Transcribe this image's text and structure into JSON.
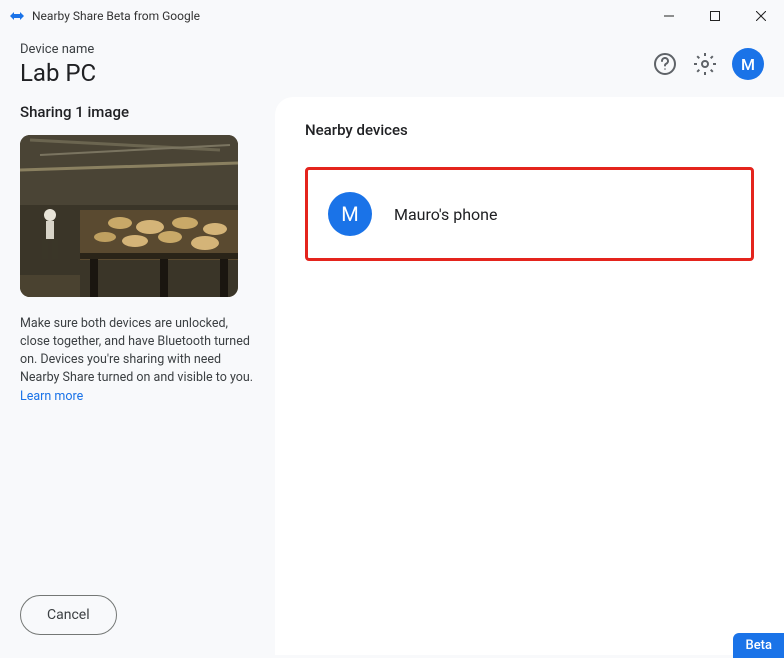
{
  "titlebar": {
    "title": "Nearby Share Beta from Google"
  },
  "header": {
    "device_label": "Device name",
    "device_name": "Lab PC",
    "avatar_initial": "M"
  },
  "left": {
    "sharing_title": "Sharing 1 image",
    "instructions": "Make sure both devices are unlocked, close together, and have Bluetooth turned on. Devices you're sharing with need Nearby Share turned on and visible to you. ",
    "learn_more": "Learn more",
    "cancel_label": "Cancel"
  },
  "right": {
    "section_title": "Nearby devices",
    "devices": [
      {
        "initial": "M",
        "name": "Mauro's phone"
      }
    ]
  },
  "beta_label": "Beta"
}
